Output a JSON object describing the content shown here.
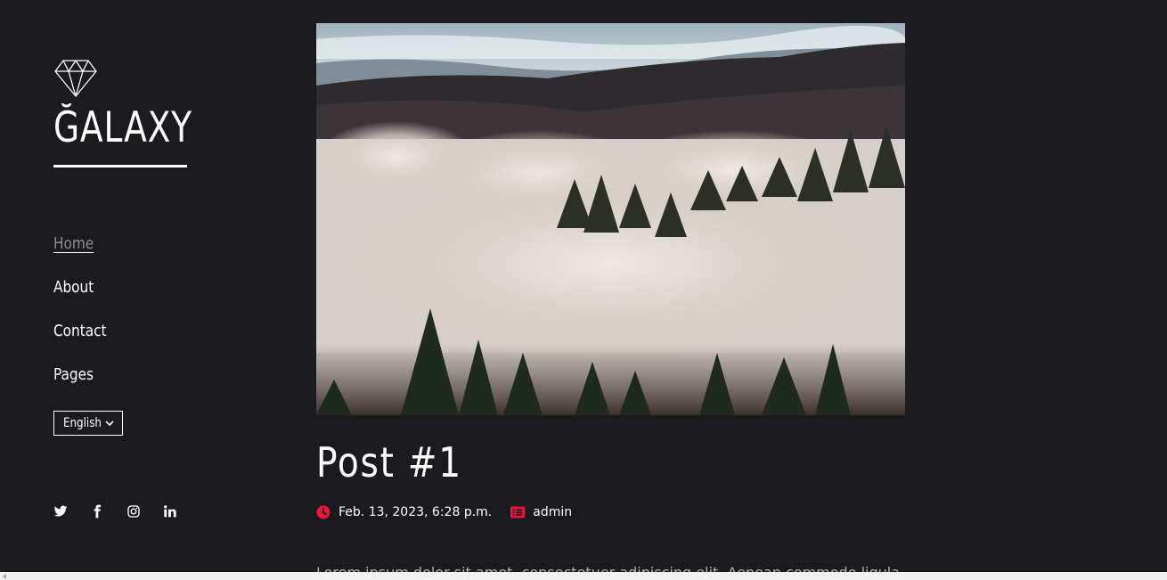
{
  "brand": {
    "name": "ĞALAXY",
    "icon": "diamond-icon"
  },
  "nav": {
    "items": [
      {
        "label": "Home",
        "active": true
      },
      {
        "label": "About"
      },
      {
        "label": "Contact"
      },
      {
        "label": "Pages"
      }
    ]
  },
  "language": {
    "selected": "English"
  },
  "social": [
    "twitter-icon",
    "facebook-icon",
    "instagram-icon",
    "linkedin-icon"
  ],
  "post": {
    "title": "Post #1",
    "date": "Feb. 13, 2023, 6:28 p.m.",
    "author": "admin",
    "excerpt": "Lorem ipsum dolor sit amet, consectetuer adipiscing elit. Aenean commodo ligula"
  },
  "colors": {
    "background": "#1b1a1f",
    "accent": "#e8173b",
    "muted": "#8c8b90"
  }
}
